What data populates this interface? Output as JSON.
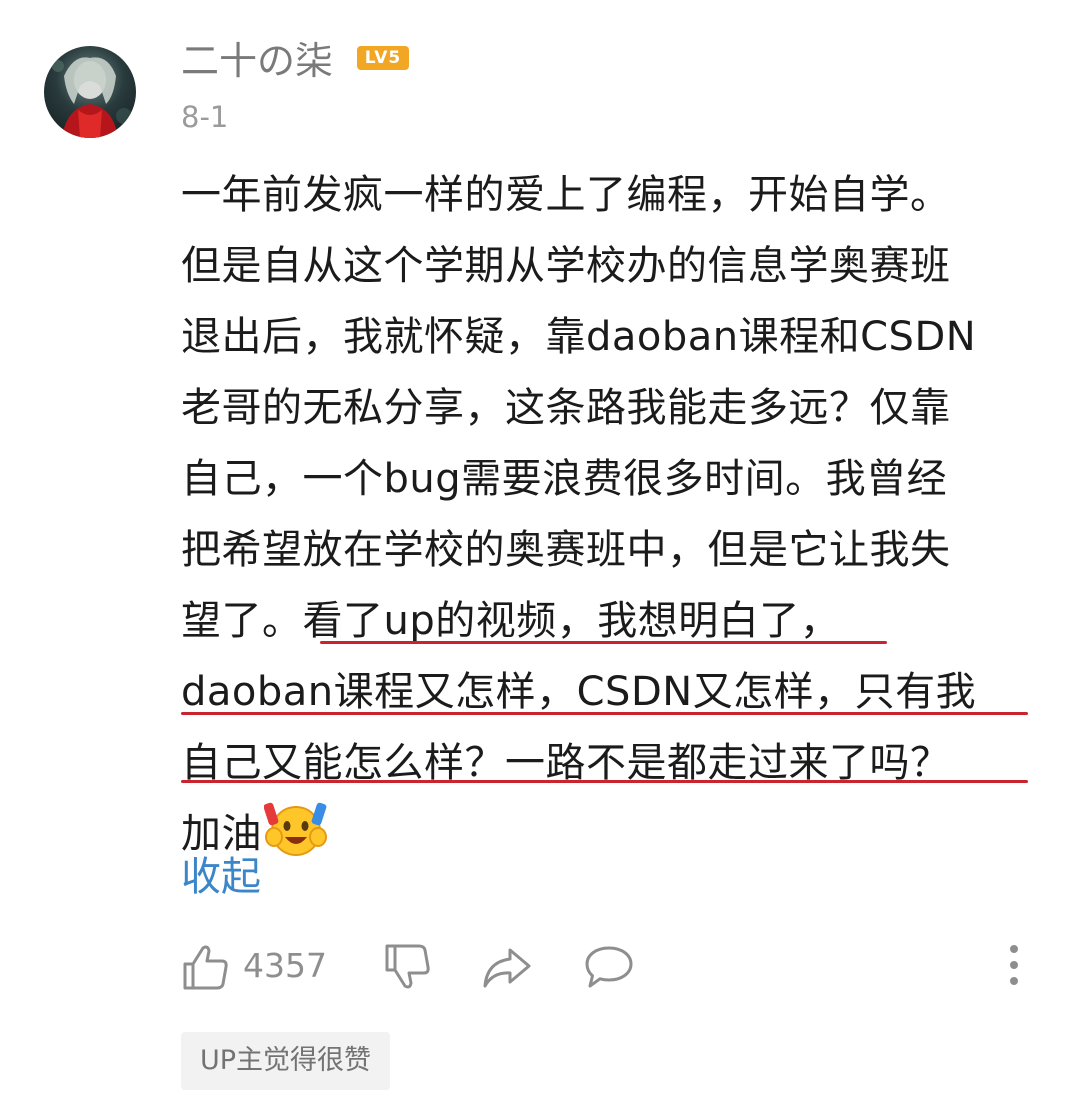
{
  "comment": {
    "username": "二十の柒",
    "level_badge": "LV5",
    "date": "8-1",
    "lines": [
      "一年前发疯一样的爱上了编程，开始自学。",
      "但是自从这个学期从学校办的信息学奥赛班",
      "退出后，我就怀疑，靠daoban课程和CSDN",
      "老哥的无私分享，这条路我能走多远？仅靠",
      "自己，一个bug需要浪费很多时间。我曾经",
      "把希望放在学校的奥赛班中，但是它让我失",
      "望了。看了up的视频，我想明白了，",
      "daoban课程又怎样，CSDN又怎样，只有我",
      "自己又能怎么样？一路不是都走过来了吗？",
      "加油"
    ],
    "collapse_label": "收起"
  },
  "actions": {
    "like_count": "4357"
  },
  "up_tag": "UP主觉得很赞",
  "colors": {
    "text": "#1b1b1b",
    "username": "#7a7a7a",
    "link": "#3b86c8",
    "highlight_underline": "#c9252f",
    "level_badge": "#f1a624"
  }
}
